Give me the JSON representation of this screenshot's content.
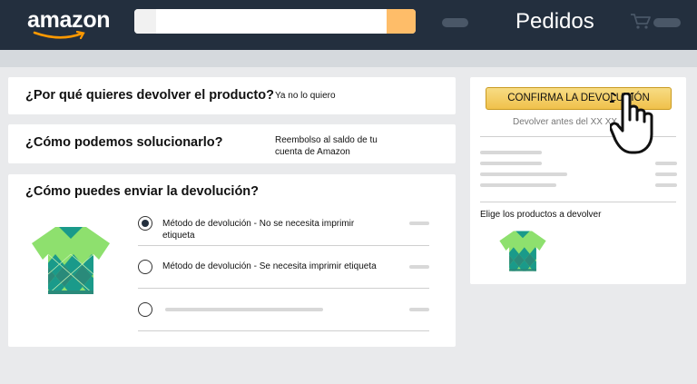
{
  "header": {
    "logo_text": "amazon",
    "page_title": "Pedidos",
    "colors": {
      "bar": "#232f3e",
      "search_button": "#febd69"
    }
  },
  "reason": {
    "question": "¿Por qué quieres devolver el producto?",
    "answer": "Ya no lo quiero"
  },
  "solution": {
    "question": "¿Cómo podemos solucionarlo?",
    "answer_line1": "Reembolso al saldo de tu",
    "answer_line2": "cuenta de Amazon"
  },
  "shipping": {
    "question": "¿Cómo puedes enviar la devolución?",
    "options": [
      {
        "label_line1": "Método de devolución - No se necesita imprimir",
        "label_line2": "etiqueta",
        "selected": true
      },
      {
        "label_line1": "Método de devolución - Se necesita imprimir etiqueta",
        "selected": false
      },
      {
        "label_line1": "",
        "selected": false
      }
    ],
    "product_icon": "argyle-polo-shirt-icon"
  },
  "summary": {
    "confirm_label": "CONFIRMA LA DEVOLUCIÓN",
    "deadline": "Devolver antes del XX XX,",
    "choose_products": "Elige los productos a devolver",
    "pointer_icon": "pointing-hand-icon",
    "accent": "#f0c14b"
  }
}
